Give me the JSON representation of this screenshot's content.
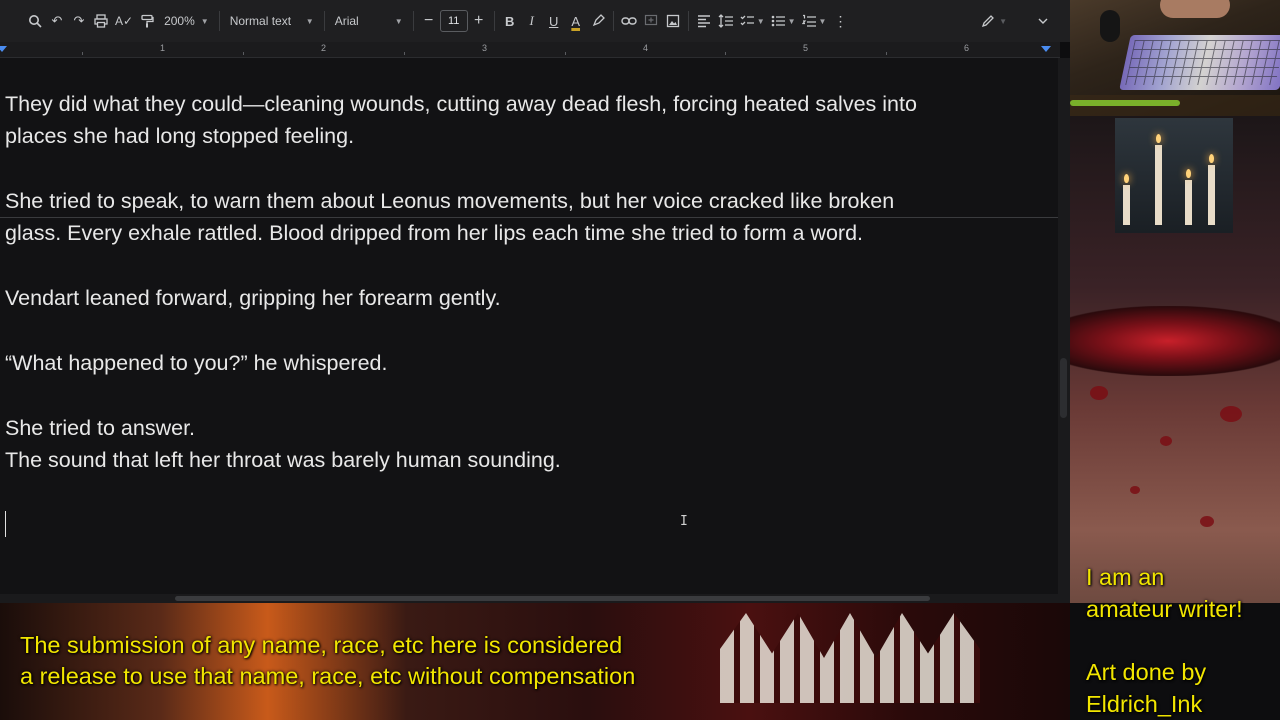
{
  "toolbar": {
    "zoom": "200%",
    "style": "Normal text",
    "font": "Arial",
    "font_size": "11"
  },
  "ruler": {
    "numbers": [
      "1",
      "2",
      "3",
      "4",
      "5",
      "6"
    ]
  },
  "document": {
    "paragraphs": [
      "They did what they could—cleaning wounds, cutting away dead flesh, forcing heated salves into",
      "places she had long stopped feeling.",
      "She tried to speak, to warn them about Leonus movements, but her voice cracked like broken",
      "glass. Every exhale rattled. Blood dripped from her lips each time she tried to form a word.",
      "Vendart leaned forward, gripping her forearm gently.",
      "“What happened to you?” he whispered.",
      "She tried to answer.",
      "The sound that left her throat was barely human sounding."
    ]
  },
  "overlay": {
    "banner_line1": "The submission of any name, race, etc here is considered",
    "banner_line2": "a release to use that name, race, etc without compensation",
    "side_line1": "I am an",
    "side_line2": "amateur writer!",
    "side_line3": "Art done by",
    "side_line4": "Eldrich_Ink"
  },
  "colors": {
    "overlay_text": "#f2e600",
    "doc_background": "#121214",
    "doc_text": "#e8e8e8"
  }
}
